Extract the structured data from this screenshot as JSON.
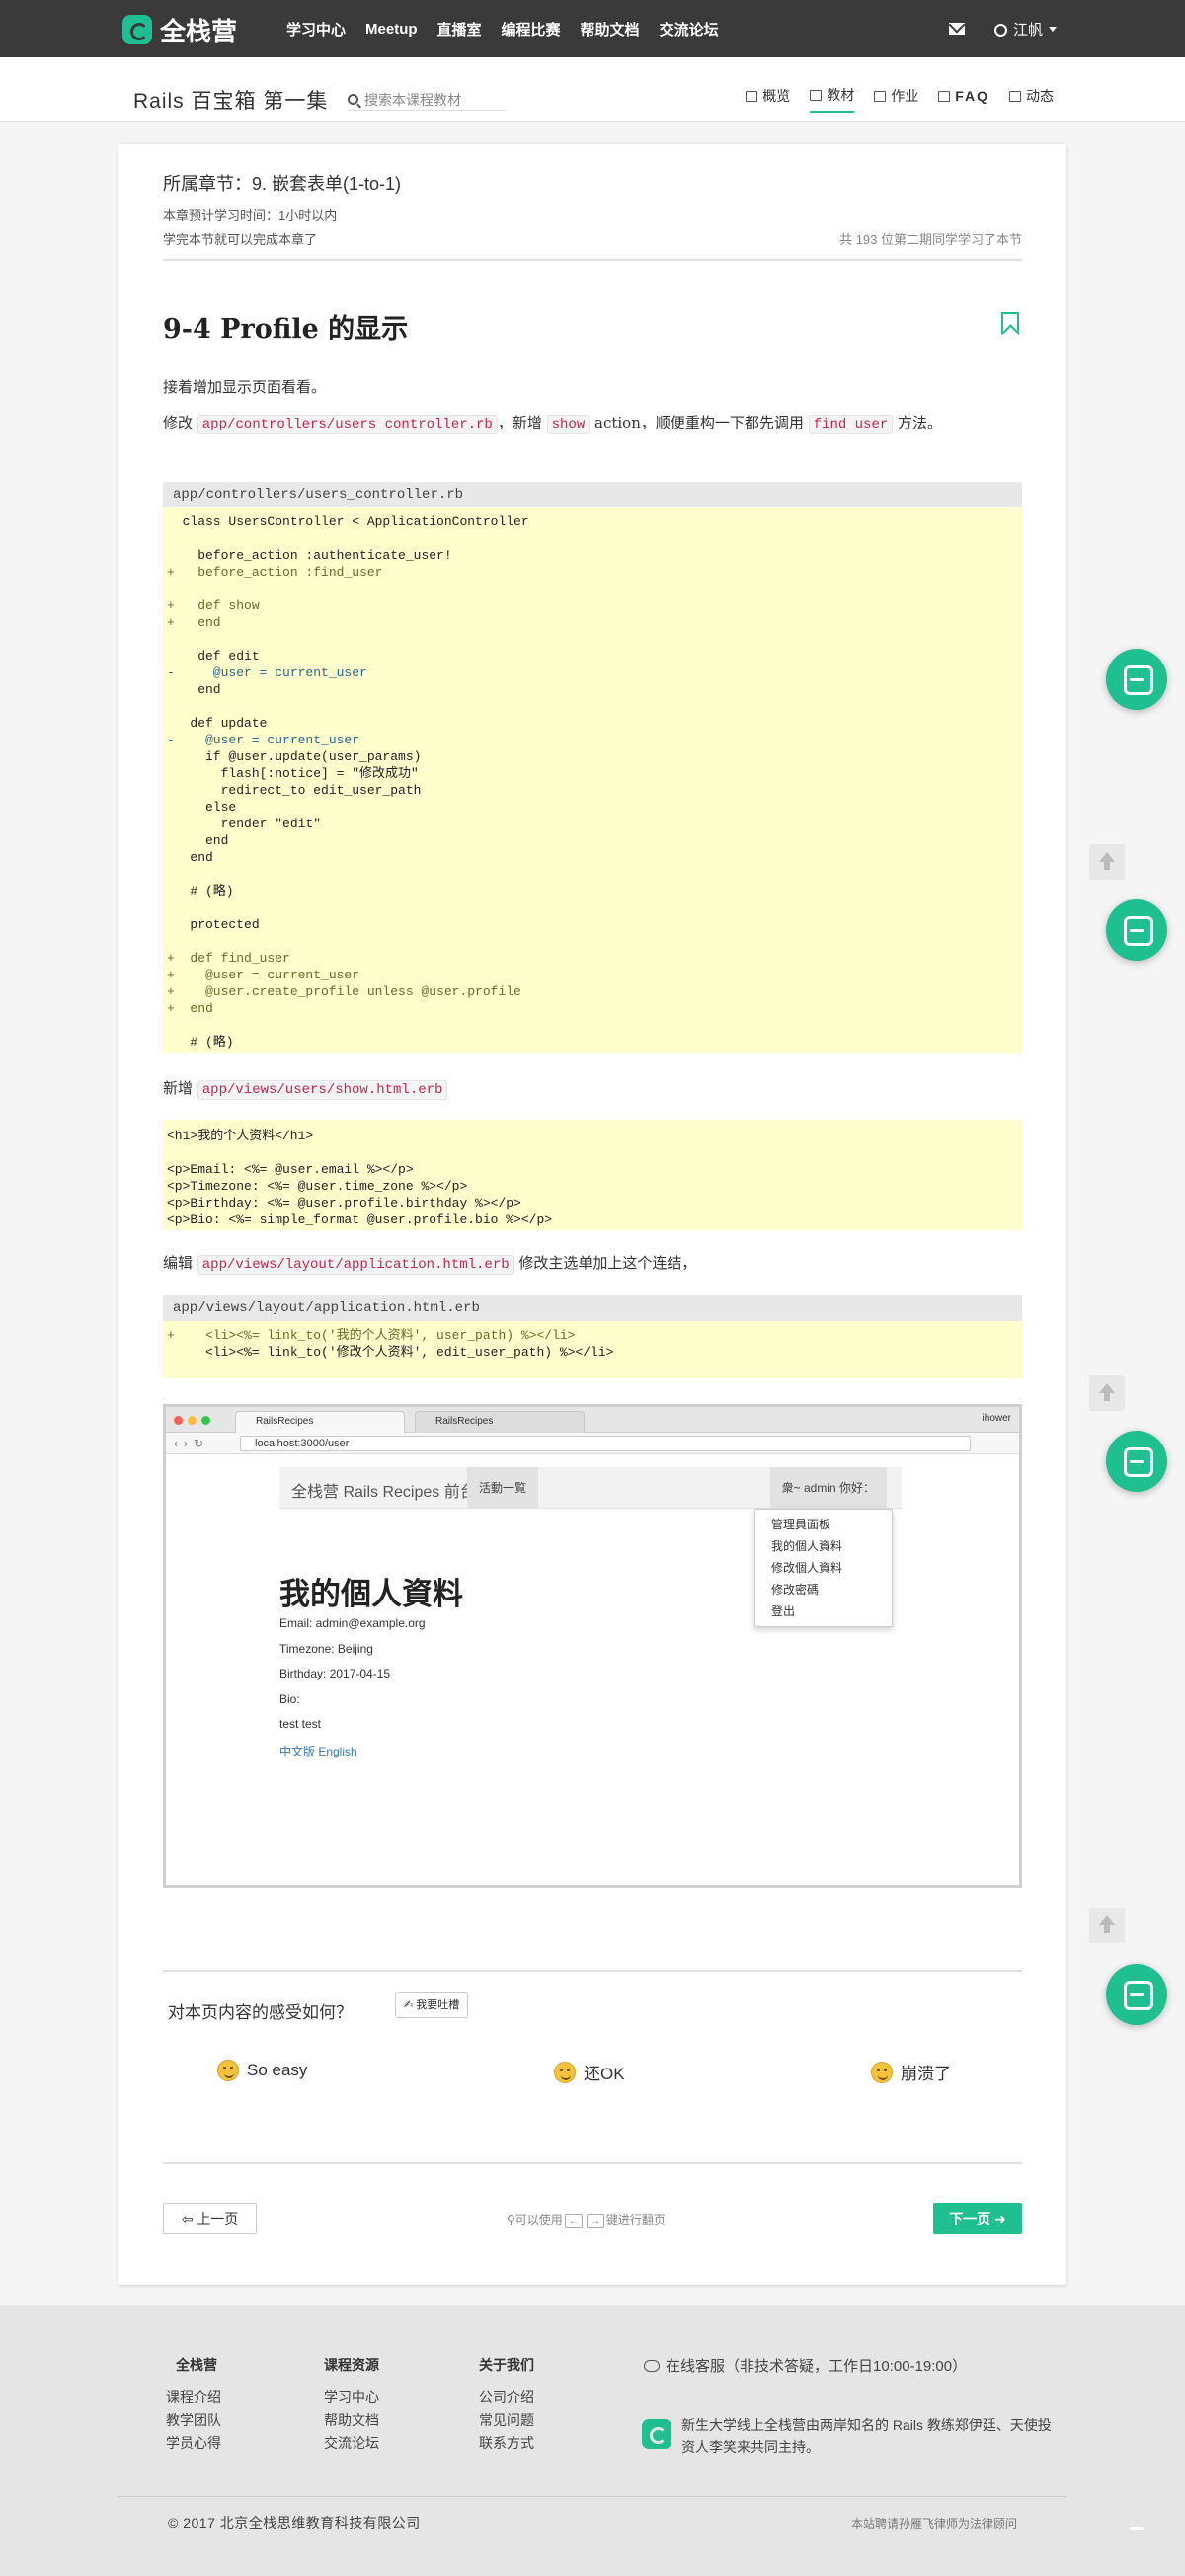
{
  "nav": {
    "brand": "全栈营",
    "links": [
      "学习中心",
      "Meetup",
      "直播室",
      "编程比赛",
      "帮助文档",
      "交流论坛"
    ],
    "user": "江帆"
  },
  "course": {
    "title": "Rails 百宝箱 第一集",
    "search_placeholder": "搜索本课程教材",
    "tabs": [
      "概览",
      "教材",
      "作业",
      "FAQ",
      "动态"
    ],
    "active_tab": "教材"
  },
  "chapter": {
    "title": "所属章节：9. 嵌套表单(1-to-1)",
    "time": "本章预计学习时间：1小时以内",
    "done": "学完本节就可以完成本章了",
    "learners": "共 193 位第二期同学学习了本节"
  },
  "section": {
    "title": "9-4 Profile 的显示",
    "p1": "接着增加显示页面看看。",
    "p2_a": "修改 ",
    "p2_code1": "app/controllers/users_controller.rb",
    "p2_b": "，新增 ",
    "p2_code2": "show",
    "p2_c": " action，顺便重构一下都先调用 ",
    "p2_code3": "find_user",
    "p2_d": " 方法。",
    "p3_a": "新增 ",
    "p3_code": "app/views/users/show.html.erb",
    "p4_a": "编辑 ",
    "p4_code": "app/views/layout/application.html.erb",
    "p4_b": " 修改主选单加上这个连结，"
  },
  "code1": {
    "file": "app/controllers/users_controller.rb",
    "lines": [
      "  class UsersController < ApplicationController",
      "",
      "    before_action :authenticate_user!",
      "+   before_action :find_user",
      "",
      "+   def show",
      "+   end",
      "",
      "    def edit",
      "-     @user = current_user",
      "    end",
      "",
      "   def update",
      "-    @user = current_user",
      "     if @user.update(user_params)",
      "       flash[:notice] = \"修改成功\"",
      "       redirect_to edit_user_path",
      "     else",
      "       render \"edit\"",
      "     end",
      "   end",
      "",
      "   # (略)",
      "",
      "   protected",
      "",
      "+  def find_user",
      "+    @user = current_user",
      "+    @user.create_profile unless @user.profile",
      "+  end",
      "",
      "   # (略)"
    ]
  },
  "code2": {
    "lines": [
      "<h1>我的个人资料</h1>",
      "",
      "<p>Email: <%= @user.email %></p>",
      "<p>Timezone: <%= @user.time_zone %></p>",
      "<p>Birthday: <%= @user.profile.birthday %></p>",
      "<p>Bio: <%= simple_format @user.profile.bio %></p>"
    ]
  },
  "code3": {
    "file": "app/views/layout/application.html.erb",
    "lines": [
      "+    <li><%= link_to('我的个人资料', user_path) %></li>",
      "     <li><%= link_to('修改个人资料', edit_user_path) %></li>"
    ]
  },
  "browser": {
    "tab1": "RailsRecipes",
    "tab2": "RailsRecipes",
    "profile_name": "ihower",
    "url": "localhost:3000/user",
    "brand": "全栈营 Rails Recipes 前台",
    "menu": "活動一覧",
    "user_menu": "衆~ admin 你好：",
    "dropdown": [
      "管理員面板",
      "我的個人資料",
      "修改個人資料",
      "修改密碼",
      "登出"
    ],
    "h1": "我的個人資料",
    "email": "Email: admin@example.org",
    "timezone": "Timezone: Beijing",
    "birthday": "Birthday: 2017-04-15",
    "bio": "Bio:",
    "bio_text": "test test",
    "langs": "中文版 English"
  },
  "feedback": {
    "question": "对本页内容的感受如何？",
    "button": "我要吐槽",
    "options": [
      "So easy",
      "还OK",
      "崩溃了"
    ]
  },
  "pager": {
    "prev": "上一页",
    "hint_a": "可以使用",
    "key_left": "←",
    "key_right": "→",
    "hint_b": "键进行翻页",
    "next": "下一页"
  },
  "footer": {
    "col1": {
      "head": "全栈营",
      "items": [
        "课程介绍",
        "教学团队",
        "学员心得"
      ]
    },
    "col2": {
      "head": "课程资源",
      "items": [
        "学习中心",
        "帮助文档",
        "交流论坛"
      ]
    },
    "col3": {
      "head": "关于我们",
      "items": [
        "公司介绍",
        "常见问题",
        "联系方式"
      ]
    },
    "service": "在线客服（非技术答疑，工作日10:00-19:00）",
    "desc": "新生大学线上全栈营由两岸知名的 Rails 教练郑伊廷、天使投资人李笑来共同主持。",
    "copyright": "© 2017 北京全栈思维教育科技有限公司",
    "legal": "本站聘请孙雁飞律师为法律顾问"
  },
  "colors": {
    "accent": "#1fbf8f",
    "nav_bg": "#3a3a3a",
    "code_bg": "#fefecc"
  }
}
